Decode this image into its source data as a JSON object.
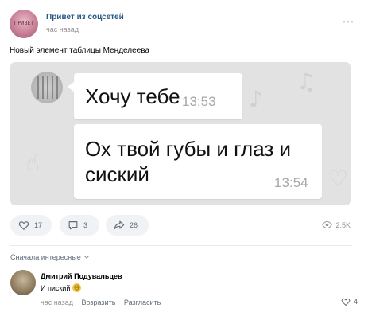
{
  "post": {
    "group_name": "Привет из соцсетей",
    "time": "час назад",
    "avatar_text": "ПРИВЕТ",
    "more_label": "···",
    "text": "Новый элемент таблицы Менделеева"
  },
  "chat": {
    "messages": [
      {
        "text": "Хочу тебе",
        "time": "13:53"
      },
      {
        "text_line1": "Ох твой губы и глаз и",
        "text_line2": "сиский",
        "time": "13:54"
      }
    ]
  },
  "actions": {
    "likes": "17",
    "comments": "3",
    "shares": "26",
    "views": "2.5K"
  },
  "comments_section": {
    "sort_label": "Сначала интересные",
    "items": [
      {
        "author": "Дмитрий Подувальцев",
        "text": "И пиский",
        "emoji": "😄",
        "time": "час назад",
        "reply_label": "Возразить",
        "report_label": "Разгласить",
        "likes": "4"
      }
    ]
  },
  "colors": {
    "link": "#2a5885",
    "muted": "#939393",
    "pill_bg": "#f0f2f5",
    "chat_bg": "#e2e2e2"
  }
}
